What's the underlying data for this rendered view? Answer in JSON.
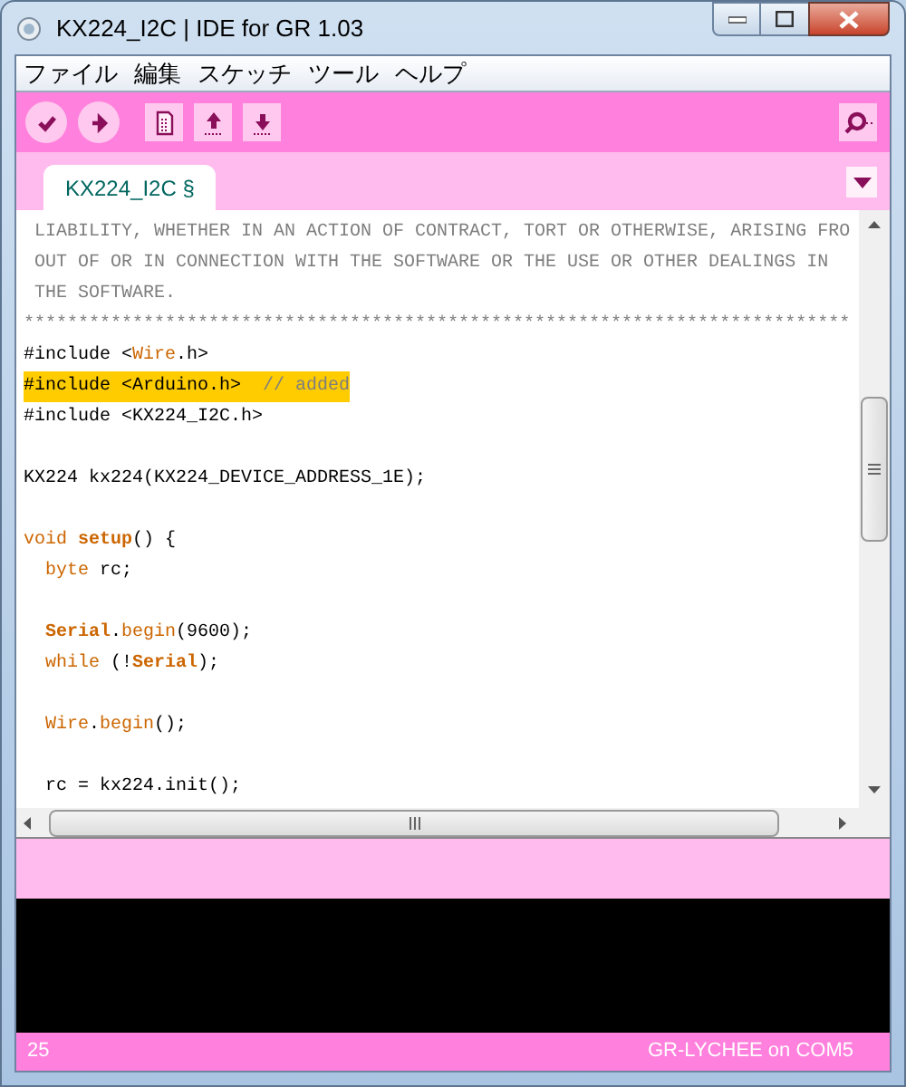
{
  "window": {
    "title": "KX224_I2C | IDE for GR 1.03"
  },
  "menu": [
    "ファイル",
    "編集",
    "スケッチ",
    "ツール",
    "ヘルプ"
  ],
  "toolbar": [
    {
      "kind": "verify"
    },
    {
      "kind": "upload"
    },
    {
      "kind": "new"
    },
    {
      "kind": "open"
    },
    {
      "kind": "save"
    }
  ],
  "tabs": [
    {
      "label": "KX224_I2C §",
      "selected": true
    }
  ],
  "editor": {
    "blocks": [
      [
        [
          {
            "text": " LIABILITY, WHETHER IN AN ACTION OF CONTRACT, TORT OR OTHERWISE, ARISING FRO",
            "kind": "comment"
          }
        ],
        [
          {
            "text": " OUT OF OR IN CONNECTION WITH THE SOFTWARE OR THE USE OR OTHER DEALINGS IN",
            "kind": "comment"
          }
        ],
        [
          {
            "text": " THE SOFTWARE.",
            "kind": "comment"
          }
        ],
        [
          {
            "text": "****************************************************************************",
            "kind": "comment"
          }
        ],
        [
          {
            "text": "#include <",
            "kind": "plain"
          },
          {
            "text": "Wire",
            "kind": "keyword"
          },
          {
            "text": ".h>",
            "kind": "plain"
          }
        ],
        {
          "highlighted": true,
          "segments": [
            {
              "text": "#include <Arduino.h>  ",
              "kind": "plain"
            },
            {
              "text": "// added",
              "kind": "comment"
            }
          ]
        },
        [
          {
            "text": "#include <KX224_I2C.h>",
            "kind": "plain"
          }
        ]
      ],
      [
        [
          {
            "text": "KX224 kx224(KX224_DEVICE_ADDRESS_1E);",
            "kind": "plain"
          }
        ]
      ],
      [
        [
          {
            "text": "void ",
            "kind": "keyword"
          },
          {
            "text": "setup",
            "kind": "strong"
          },
          {
            "text": "() {",
            "kind": "plain"
          }
        ],
        [
          {
            "text": "  byte",
            "kind": "keyword"
          },
          {
            "text": " rc;",
            "kind": "plain"
          }
        ]
      ],
      [
        [
          {
            "text": "  Serial",
            "kind": "strong"
          },
          {
            "text": ".",
            "kind": "plain"
          },
          {
            "text": "begin",
            "kind": "keyword"
          },
          {
            "text": "(9600);",
            "kind": "plain"
          }
        ],
        [
          {
            "text": "  while",
            "kind": "keyword"
          },
          {
            "text": " (!",
            "kind": "plain"
          },
          {
            "text": "Serial",
            "kind": "strong"
          },
          {
            "text": ");",
            "kind": "plain"
          }
        ]
      ],
      [
        [
          {
            "text": "  Wire",
            "kind": "keyword"
          },
          {
            "text": ".",
            "kind": "plain"
          },
          {
            "text": "begin",
            "kind": "keyword"
          },
          {
            "text": "();",
            "kind": "plain"
          }
        ]
      ],
      [
        [
          {
            "text": "  rc = kx224.init();",
            "kind": "plain"
          }
        ]
      ]
    ]
  },
  "status_bar": {
    "line": "25",
    "board": "GR-LYCHEE on COM5"
  }
}
